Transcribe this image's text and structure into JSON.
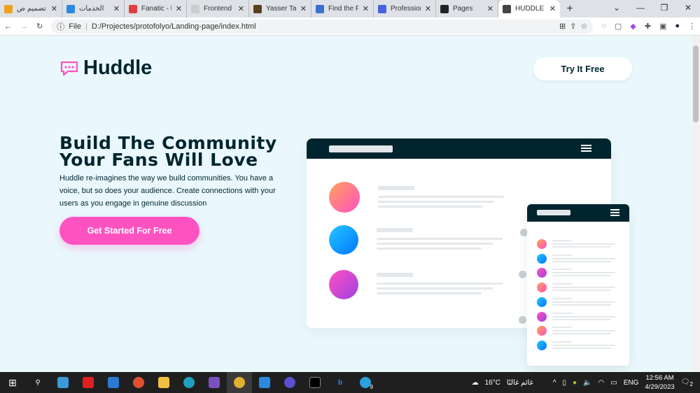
{
  "browser": {
    "tabs": [
      {
        "title": "تصميم ص",
        "color": "#f0a020"
      },
      {
        "title": "الخدمات",
        "color": "#2a8ae0"
      },
      {
        "title": "Fanatic - F",
        "color": "#e04040"
      },
      {
        "title": "Frontend M",
        "color": "#cccccc"
      },
      {
        "title": "Yasser Taw",
        "color": "#5a4020"
      },
      {
        "title": "Find the Pr",
        "color": "#3a70d0"
      },
      {
        "title": "Professiona",
        "color": "#4a60e0"
      },
      {
        "title": "Pages",
        "color": "#222222"
      },
      {
        "title": "HUDDLE",
        "color": "#444444",
        "active": true
      }
    ],
    "new_tab": "+",
    "file_label": "File",
    "url": "D:/Projectes/protofolyo/Landing-page/index.html"
  },
  "page": {
    "logo": "Huddle",
    "try_button": "Try It Free",
    "headline": "Build The Community Your Fans Will Love",
    "description": "Huddle re-imagines the way we build communities. You have a voice, but so does your audience. Create connections with your users as you engage in genuine discussion",
    "cta": "Get Started For Free",
    "accent": "#ff52c1",
    "dark": "#00252e"
  },
  "taskbar": {
    "weather_temp": "16°C",
    "weather_text": "غائم غالبًا",
    "lang": "ENG",
    "time": "12:56 AM",
    "date": "4/29/2023",
    "notifications": "2",
    "badge": "9"
  }
}
